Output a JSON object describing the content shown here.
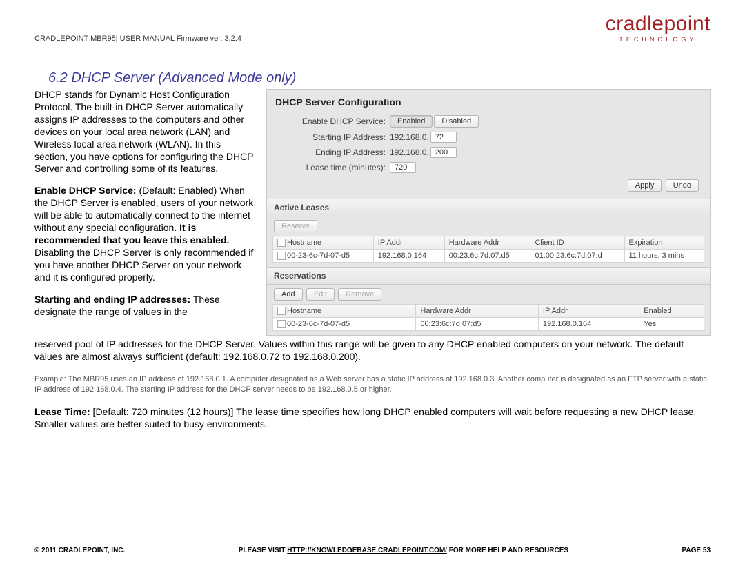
{
  "doc_header": "CRADLEPOINT MBR95| USER MANUAL Firmware ver. 3.2.4",
  "brand": {
    "main": "cradlepoint",
    "sub": "TECHNOLOGY"
  },
  "section_title": "6.2  DHCP Server (Advanced Mode only)",
  "intro": "DHCP stands for Dynamic Host Configuration Protocol. The built-in DHCP Server automatically assigns IP addresses to the computers and other devices on your local area network (LAN) and Wireless local area network (WLAN). In this section, you have options for configuring the DHCP Server and controlling some of its features.",
  "enable_label": "Enable DHCP Service:",
  "enable_default": " (Default: Enabled) When the DHCP Server is enabled, users of your network will be able to automatically connect to the internet without any special configuration. ",
  "enable_bold2": "It is recommended that you leave this enabled.",
  "enable_tail": " Disabling the DHCP Server is only recommended if you have another DHCP Server on your network and it is configured properly.",
  "start_label": "Starting and ending IP addresses:",
  "start_text1": " These designate the range of values in the",
  "start_text2": "reserved pool of IP addresses for the DHCP Server. Values within this range will be given to any DHCP enabled computers on your network. The default values are almost always sufficient (default: 192.168.0.72 to 192.168.0.200).",
  "example": "Example: The MBR95 uses an IP address of 192.168.0.1. A computer designated as a Web server has a static IP address of 192.168.0.3. Another computer is designated as an FTP server with a static IP address of 192.168.0.4. The starting IP address for the DHCP server needs to be 192.168.0.5 or higher.",
  "lease_label": "Lease Time:",
  "lease_text": " [Default: 720 minutes (12 hours)] The lease time specifies how long DHCP enabled computers will wait before requesting a new DHCP lease. Smaller values are better suited to busy environments.",
  "panel": {
    "title": "DHCP Server Configuration",
    "rows": {
      "enable": "Enable DHCP Service:",
      "enabled_btn": "Enabled",
      "disabled_btn": "Disabled",
      "start": "Starting IP Address:",
      "start_prefix": "192.168.0.",
      "start_val": "72",
      "end": "Ending IP Address:",
      "end_prefix": "192.168.0.",
      "end_val": "200",
      "lease": "Lease time (minutes):",
      "lease_val": "720",
      "apply": "Apply",
      "undo": "Undo"
    },
    "leases": {
      "head": "Active Leases",
      "reserve": "Reserve",
      "cols": [
        "Hostname",
        "IP Addr",
        "Hardware Addr",
        "Client ID",
        "Expiration"
      ],
      "row": [
        "00-23-6c-7d-07-d5",
        "192.168.0.164",
        "00:23:6c:7d:07:d5",
        "01:00:23:6c:7d:07:d",
        "11 hours, 3 mins"
      ]
    },
    "res": {
      "head": "Reservations",
      "add": "Add",
      "edit": "Edit",
      "remove": "Remove",
      "cols": [
        "Hostname",
        "Hardware Addr",
        "IP Addr",
        "Enabled"
      ],
      "row": [
        "00-23-6c-7d-07-d5",
        "00:23:6c:7d:07:d5",
        "192.168.0.164",
        "Yes"
      ]
    }
  },
  "footer": {
    "left": "© 2011 CRADLEPOINT, INC.",
    "mid_pre": "PLEASE VISIT ",
    "mid_link": "HTTP://KNOWLEDGEBASE.CRADLEPOINT.COM/",
    "mid_post": " FOR MORE HELP AND RESOURCES",
    "right": "PAGE 53"
  }
}
